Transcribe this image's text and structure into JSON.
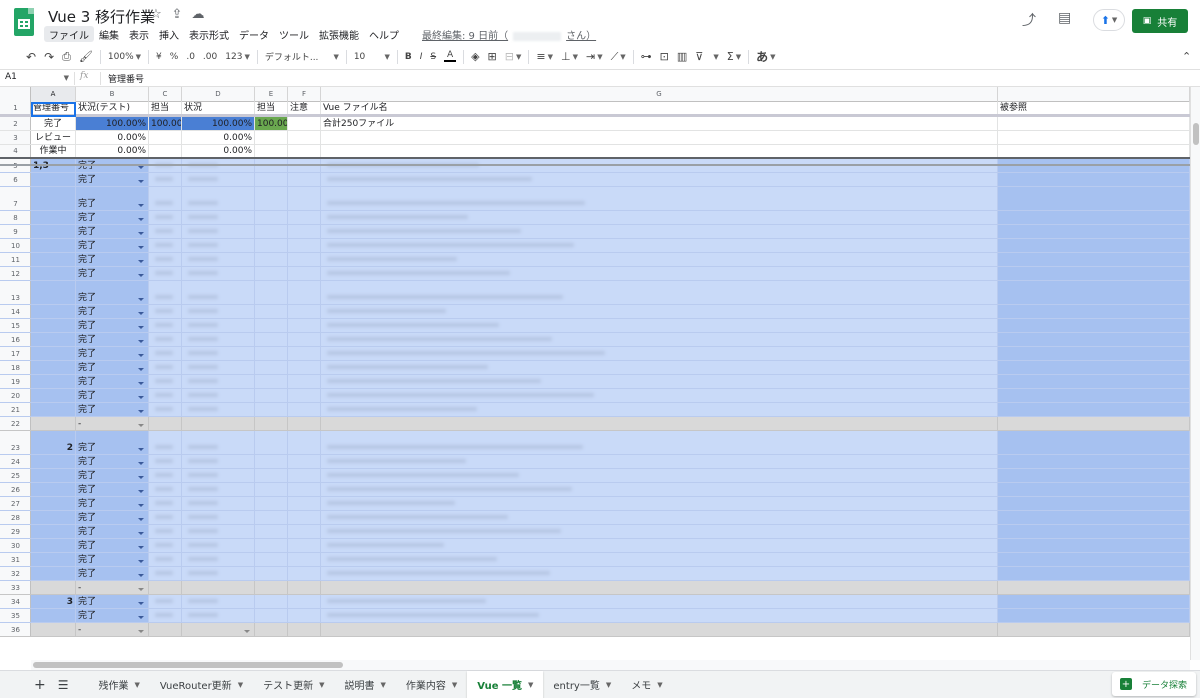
{
  "document": {
    "title": "Vue 3 移行作業",
    "last_edit": "最終編集: 9 日前（",
    "last_edit_suffix": "さん）"
  },
  "menu": [
    "ファイル",
    "編集",
    "表示",
    "挿入",
    "表示形式",
    "データ",
    "ツール",
    "拡張機能",
    "ヘルプ"
  ],
  "share_label": "共有",
  "toolbar": {
    "zoom": "100%",
    "currency": "¥",
    "percent": "%",
    "dec_decrease": ".0",
    "dec_increase": ".00",
    "more_formats": "123",
    "font": "デフォルト...",
    "font_size": "10",
    "bold": "B",
    "italic": "I",
    "strike": "S",
    "text_color": "A",
    "input_tools": "あ",
    "sigma": "Σ"
  },
  "formula_bar": {
    "cell_ref": "A1",
    "fx": "fx",
    "value": "管理番号"
  },
  "columns": [
    {
      "letter": "A"
    },
    {
      "letter": "B"
    },
    {
      "letter": "C"
    },
    {
      "letter": "D"
    },
    {
      "letter": "E"
    },
    {
      "letter": "F"
    },
    {
      "letter": "G"
    },
    {
      "letter": ""
    }
  ],
  "rows": [
    {
      "n": "1",
      "cells": [
        "管理番号",
        "状況(テスト)",
        "担当",
        "状況",
        "担当",
        "注意",
        "Vue ファイル名",
        "被参照"
      ]
    },
    {
      "n": "2",
      "cells": [
        "完了",
        "100.00%",
        "100.00",
        "100.00%",
        "100.00",
        "",
        "合計250ファイル",
        ""
      ]
    },
    {
      "n": "3",
      "cells": [
        "レビュー",
        "0.00%",
        "",
        "0.00%",
        "",
        "",
        "",
        ""
      ]
    },
    {
      "n": "4",
      "cells": [
        "作業中",
        "0.00%",
        "",
        "0.00%",
        "",
        "",
        "",
        ""
      ]
    },
    {
      "n": "5",
      "cells": [
        "1,3",
        "完了"
      ]
    },
    {
      "n": "6",
      "cells": [
        "",
        "完了"
      ]
    },
    {
      "n": "7",
      "cells": [
        "",
        "完了"
      ]
    },
    {
      "n": "8",
      "cells": [
        "",
        "完了"
      ]
    },
    {
      "n": "9",
      "cells": [
        "",
        "完了"
      ]
    },
    {
      "n": "10",
      "cells": [
        "",
        "完了"
      ]
    },
    {
      "n": "11",
      "cells": [
        "",
        "完了"
      ]
    },
    {
      "n": "12",
      "cells": [
        "",
        "完了"
      ]
    },
    {
      "n": "13",
      "cells": [
        "",
        "完了"
      ]
    },
    {
      "n": "14",
      "cells": [
        "",
        "完了"
      ]
    },
    {
      "n": "15",
      "cells": [
        "",
        "完了"
      ]
    },
    {
      "n": "16",
      "cells": [
        "",
        "完了"
      ]
    },
    {
      "n": "17",
      "cells": [
        "",
        "完了"
      ]
    },
    {
      "n": "18",
      "cells": [
        "",
        "完了"
      ]
    },
    {
      "n": "19",
      "cells": [
        "",
        "完了"
      ]
    },
    {
      "n": "20",
      "cells": [
        "",
        "完了"
      ]
    },
    {
      "n": "21",
      "cells": [
        "",
        "完了"
      ]
    },
    {
      "n": "22",
      "cells": [
        "",
        "-"
      ]
    },
    {
      "n": "23",
      "cells": [
        "2",
        "完了"
      ]
    },
    {
      "n": "24",
      "cells": [
        "",
        "完了"
      ]
    },
    {
      "n": "25",
      "cells": [
        "",
        "完了"
      ]
    },
    {
      "n": "26",
      "cells": [
        "",
        "完了"
      ]
    },
    {
      "n": "27",
      "cells": [
        "",
        "完了"
      ]
    },
    {
      "n": "28",
      "cells": [
        "",
        "完了"
      ]
    },
    {
      "n": "29",
      "cells": [
        "",
        "完了"
      ]
    },
    {
      "n": "30",
      "cells": [
        "",
        "完了"
      ]
    },
    {
      "n": "31",
      "cells": [
        "",
        "完了"
      ]
    },
    {
      "n": "32",
      "cells": [
        "",
        "完了"
      ]
    },
    {
      "n": "33",
      "cells": [
        "",
        "-"
      ]
    },
    {
      "n": "34",
      "cells": [
        "3",
        "完了"
      ]
    },
    {
      "n": "35",
      "cells": [
        "",
        "完了"
      ]
    },
    {
      "n": "36",
      "cells": [
        "",
        "-"
      ]
    }
  ],
  "sheet_tabs": [
    "残作業",
    "VueRouter更新",
    "テスト更新",
    "説明書",
    "作業内容",
    "Vue 一覧",
    "entry一覧",
    "メモ"
  ],
  "active_tab": "Vue 一覧",
  "explore_label": "データ探索",
  "colors": {
    "brand_green": "#188038",
    "done_row_blue": "#a6c1f0",
    "done_row_light": "#c9daf8",
    "progress_blue": "#4a7fd4",
    "progress_green": "#6aa84f",
    "separator_grey": "#d9d9d9"
  },
  "icons": [
    "sheets-logo-icon",
    "star-icon",
    "move-icon",
    "cloud-icon",
    "trend-icon",
    "comment-icon",
    "present-icon",
    "lock-icon",
    "undo-icon",
    "redo-icon",
    "print-icon",
    "paint-format-icon",
    "fill-color-icon",
    "borders-icon",
    "merge-icon",
    "align-icon",
    "valign-icon",
    "wrap-icon",
    "rotate-icon",
    "link-icon",
    "insert-comment-icon",
    "insert-chart-icon",
    "filter-icon",
    "collapse-icon",
    "add-sheet-icon",
    "sheet-list-icon"
  ]
}
